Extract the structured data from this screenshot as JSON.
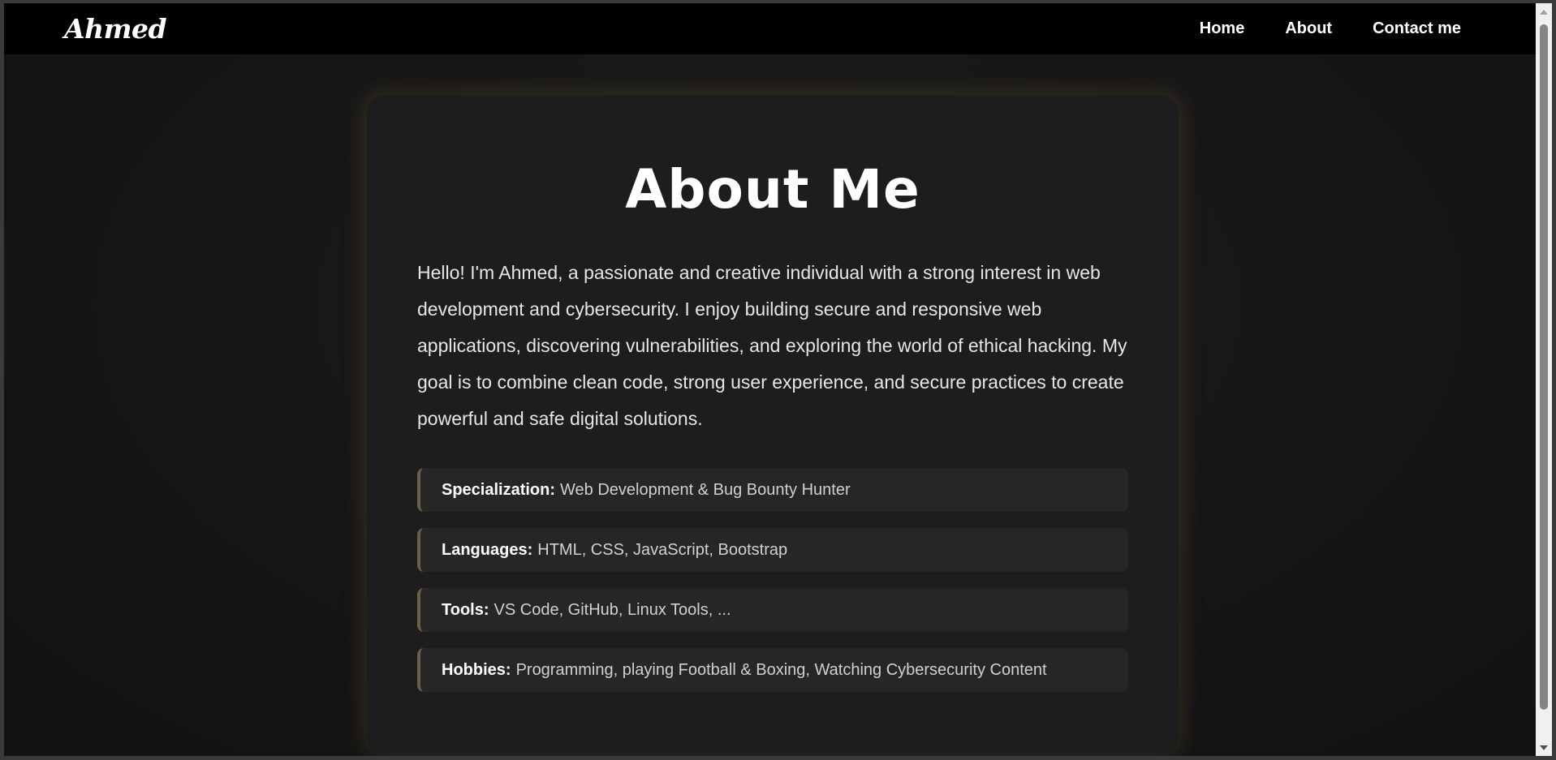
{
  "navbar": {
    "brand": "Ahmed",
    "links": [
      "Home",
      "About",
      "Contact me"
    ]
  },
  "about": {
    "title": "About Me",
    "intro": "Hello! I'm Ahmed, a passionate and creative individual with a strong interest in web development and cybersecurity. I enjoy building secure and responsive web applications, discovering vulnerabilities, and exploring the world of ethical hacking. My goal is to combine clean code, strong user experience, and secure practices to create powerful and safe digital solutions.",
    "items": [
      {
        "label": "Specialization:",
        "value": "Web Development & Bug Bounty Hunter"
      },
      {
        "label": "Languages:",
        "value": "HTML, CSS, JavaScript, Bootstrap"
      },
      {
        "label": "Tools:",
        "value": "VS Code, GitHub, Linux Tools, ..."
      },
      {
        "label": "Hobbies:",
        "value": "Programming, playing Football & Boxing, Watching Cybersecurity Content"
      }
    ]
  },
  "colors": {
    "navbar_bg": "#000000",
    "card_bg": "#1d1d1d",
    "item_bg": "#262626",
    "accent_border": "#6e5c45"
  }
}
